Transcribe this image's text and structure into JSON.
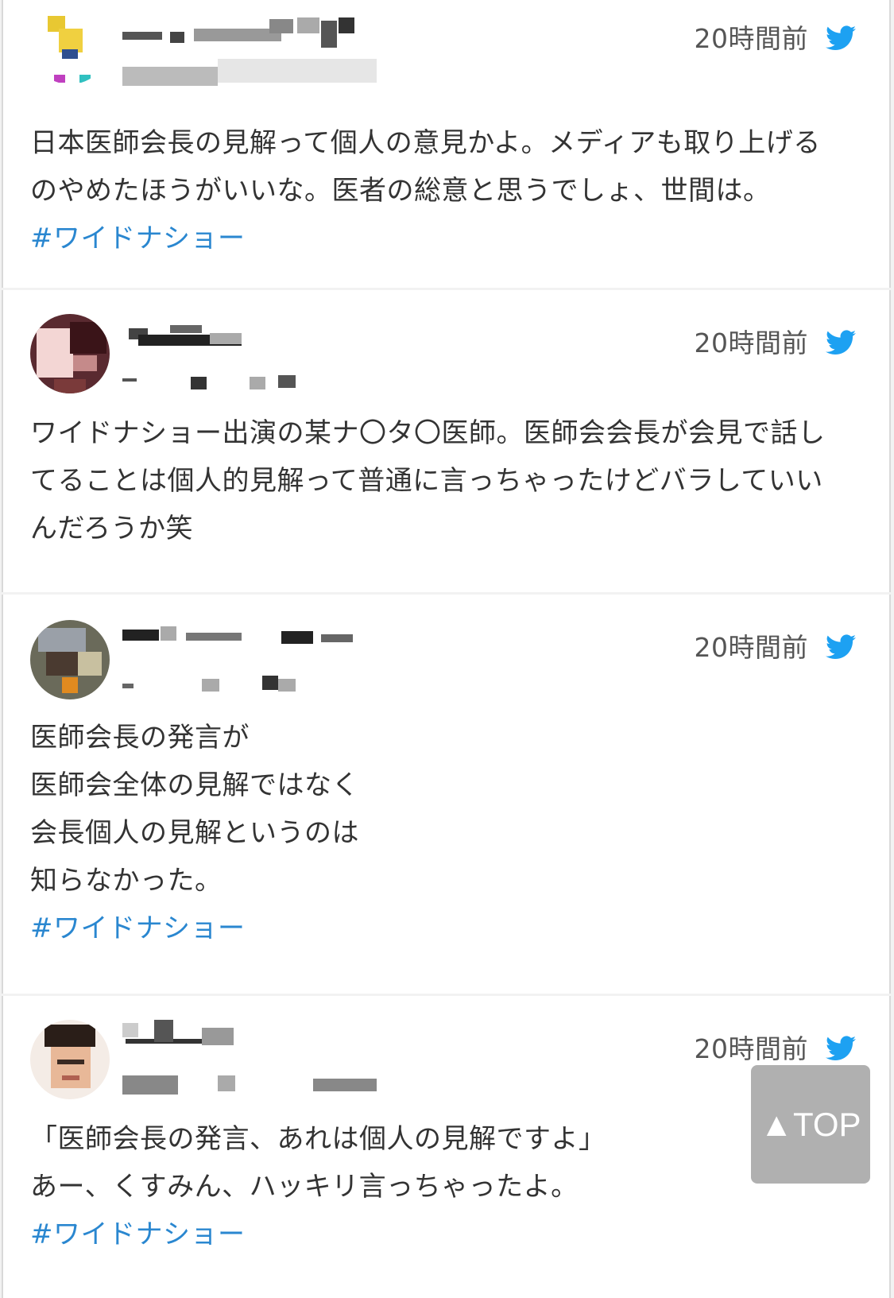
{
  "tweets": [
    {
      "time": "20時間前",
      "text": "日本医師会長の見解って個人の意見かよ。メディアも取り上げる\nのやめたほうがいいな。医者の総意と思うでしょ、世間は。",
      "hashtag": "#ワイドナショー",
      "avatar_icon": "avatar-icon",
      "brand_icon": "twitter-bird-icon"
    },
    {
      "time": "20時間前",
      "text": "ワイドナショー出演の某ナ〇タ〇医師。医師会会長が会見で話し\nてることは個人的見解って普通に言っちゃったけどバラしていい\nんだろうか笑",
      "hashtag": "",
      "avatar_icon": "avatar-icon",
      "brand_icon": "twitter-bird-icon"
    },
    {
      "time": "20時間前",
      "text": "医師会長の発言が\n医師会全体の見解ではなく\n会長個人の見解というのは\n知らなかった。",
      "hashtag": "#ワイドナショー",
      "avatar_icon": "avatar-icon",
      "brand_icon": "twitter-bird-icon"
    },
    {
      "time": "20時間前",
      "text": "「医師会長の発言、あれは個人の見解ですよ」\nあー、くすみん、ハッキリ言っちゃったよ。",
      "hashtag": "#ワイドナショー",
      "avatar_icon": "avatar-icon",
      "brand_icon": "twitter-bird-icon"
    }
  ],
  "top_button": {
    "label": "▲TOP"
  },
  "colors": {
    "hashtag": "#2a87d0",
    "twitter": "#1da1f2",
    "top_button_bg": "#b0b0b0"
  }
}
